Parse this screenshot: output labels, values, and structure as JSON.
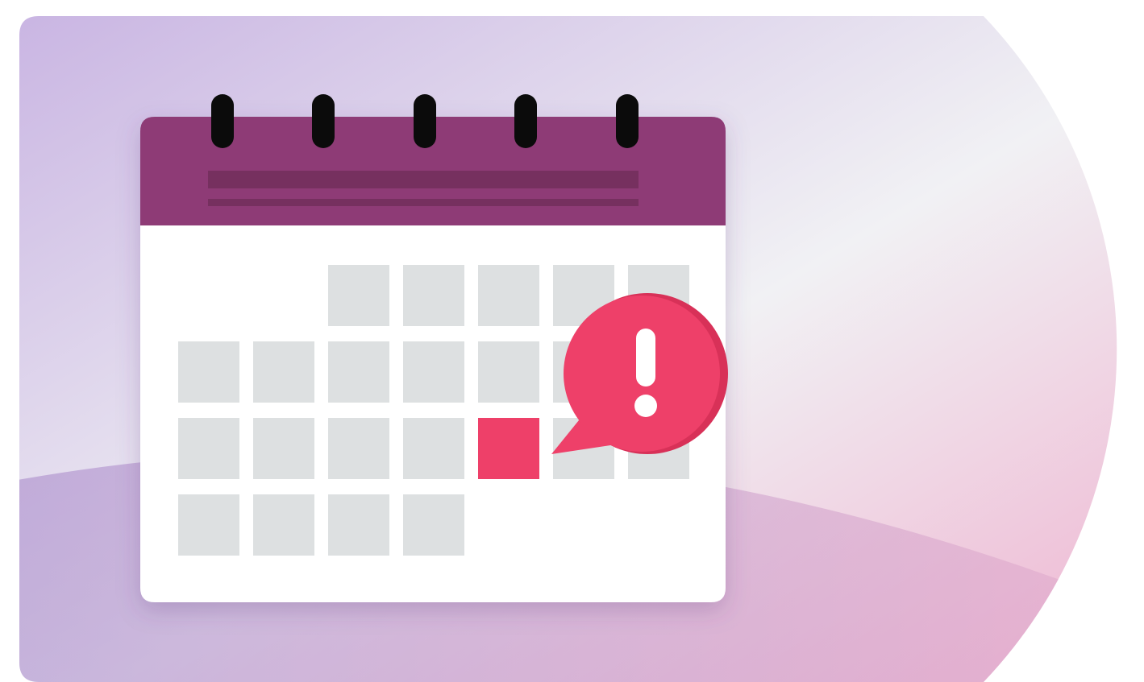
{
  "illustration": {
    "subject": "calendar-with-alert",
    "colors": {
      "page_background": "#ffffff",
      "gradient_purple": "#c8b3e2",
      "gradient_light": "#f1f1f4",
      "gradient_pink": "#eeb3d0",
      "lower_band_purple": "#a484c8",
      "lower_band_pink": "#e2aacb",
      "calendar_header": "#8e3a76",
      "header_bar": "#76305f",
      "spiral_ring": "#0b0b0b",
      "calendar_body": "#ffffff",
      "day_cell": "#dde0e1",
      "highlighted_day": "#ee4069",
      "alert_bubble": "#ee4069",
      "alert_bubble_shade": "#d83158",
      "alert_mark": "#ffffff"
    },
    "calendar": {
      "ring_count": 5,
      "weeks": [
        [
          "empty",
          "empty",
          "day",
          "day",
          "day",
          "day",
          "day"
        ],
        [
          "day",
          "day",
          "day",
          "day",
          "day",
          "day",
          "day"
        ],
        [
          "day",
          "day",
          "day",
          "day",
          "highlight",
          "day",
          "day"
        ],
        [
          "day",
          "day",
          "day",
          "day",
          "empty",
          "empty",
          "empty"
        ]
      ]
    },
    "alert": {
      "icon": "exclamation-icon"
    }
  }
}
